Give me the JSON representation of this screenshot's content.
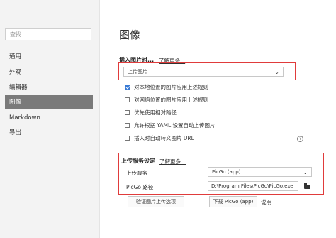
{
  "sidebar": {
    "search_placeholder": "查找...",
    "items": [
      "通用",
      "外观",
      "编辑器",
      "图像",
      "Markdown",
      "导出"
    ],
    "active": "图像"
  },
  "page": {
    "title": "图像"
  },
  "insert_image": {
    "label": "插入图片时...",
    "learn_more": "了解更多...",
    "selected_option": "上传图片",
    "options": [
      {
        "label": "对本地位置的图片应用上述规则",
        "checked": true
      },
      {
        "label": "对网络位置的图片应用上述规则",
        "checked": false
      },
      {
        "label": "优先使用相对路径",
        "checked": false
      },
      {
        "label": "允许根据 YAML 设置自动上传图片",
        "checked": false
      },
      {
        "label": "插入时自动转义图片 URL",
        "checked": false
      }
    ],
    "help_glyph": "?"
  },
  "upload_service": {
    "label": "上传服务设定",
    "learn_more": "了解更多...",
    "service_label": "上传服务",
    "service_value": "PicGo (app)",
    "path_label": "PicGo 路径",
    "path_value": "D:\\Program Files\\PicGo\\PicGo.exe",
    "verify_button": "验证图片上传选项",
    "download_button": "下载 PicGo (app)",
    "help_link": "说明"
  },
  "colors": {
    "highlight": "#e03b3b",
    "active_nav": "#7a7a7a",
    "checkbox": "#3a7bd5"
  }
}
